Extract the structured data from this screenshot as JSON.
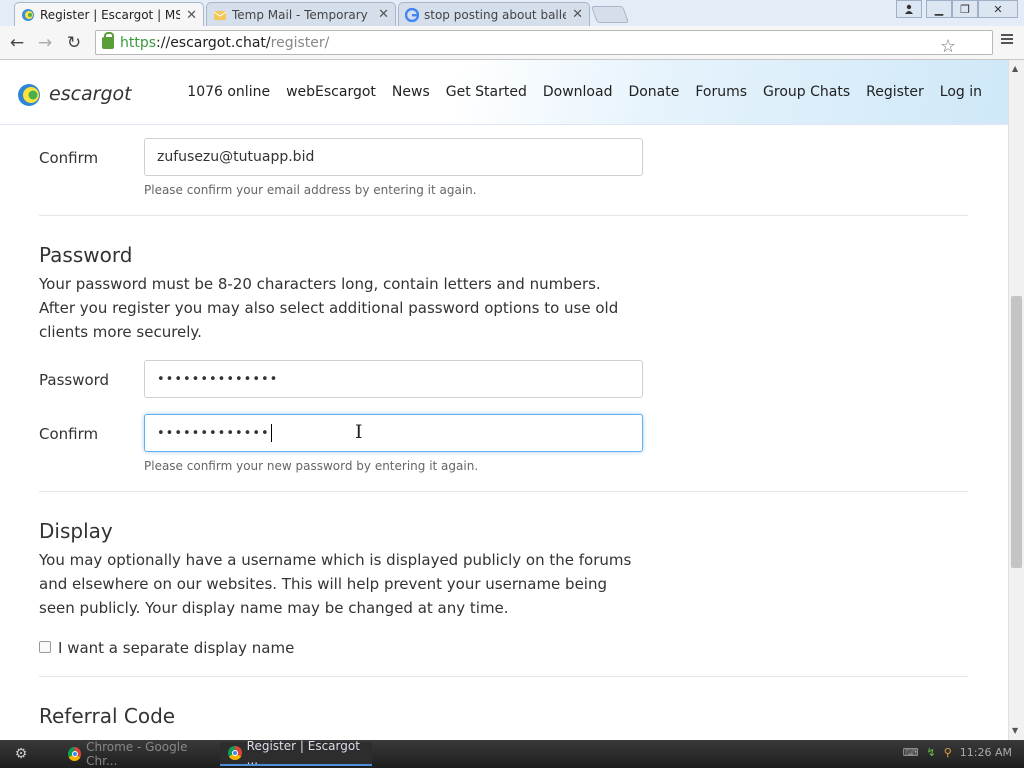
{
  "browser": {
    "tabs": [
      {
        "title": "Register | Escargot | MS",
        "active": true,
        "icon": "escargot-favicon"
      },
      {
        "title": "Temp Mail - Temporary D",
        "active": false,
        "icon": "tempmail-favicon"
      },
      {
        "title": "stop posting about balle",
        "active": false,
        "icon": "google-favicon"
      }
    ],
    "address": {
      "scheme": "https",
      "host": "://escargot.chat/",
      "path": "register/"
    }
  },
  "site": {
    "brand": "escargot",
    "nav": [
      "1076 online",
      "webEscargot",
      "News",
      "Get Started",
      "Download",
      "Donate",
      "Forums",
      "Group Chats",
      "Register",
      "Log in"
    ]
  },
  "form": {
    "email_confirm_label": "Confirm",
    "email_confirm_value": "zufusezu@tutuapp.bid",
    "email_confirm_help": "Please confirm your email address by entering it again.",
    "password_heading": "Password",
    "password_desc": "Your password must be 8-20 characters long, contain letters and numbers. After you register you may also select additional password options to use old clients more securely.",
    "password_label": "Password",
    "password_value": "••••••••••••••",
    "password_confirm_label": "Confirm",
    "password_confirm_value": "•••••••••••••",
    "password_confirm_help": "Please confirm your new password by entering it again.",
    "display_heading": "Display",
    "display_desc": "You may optionally have a username which is displayed publicly on the forums and elsewhere on our websites. This will help prevent your username being seen publicly. Your display name may be changed at any time.",
    "display_checkbox_label": "I want a separate display name",
    "display_checkbox_checked": false,
    "referral_heading": "Referral Code"
  },
  "taskbar": {
    "items": [
      {
        "title": "Chrome - Google Chr...",
        "active": false
      },
      {
        "title": "Register | Escargot ...",
        "active": true
      }
    ],
    "clock": "11:26 AM"
  }
}
